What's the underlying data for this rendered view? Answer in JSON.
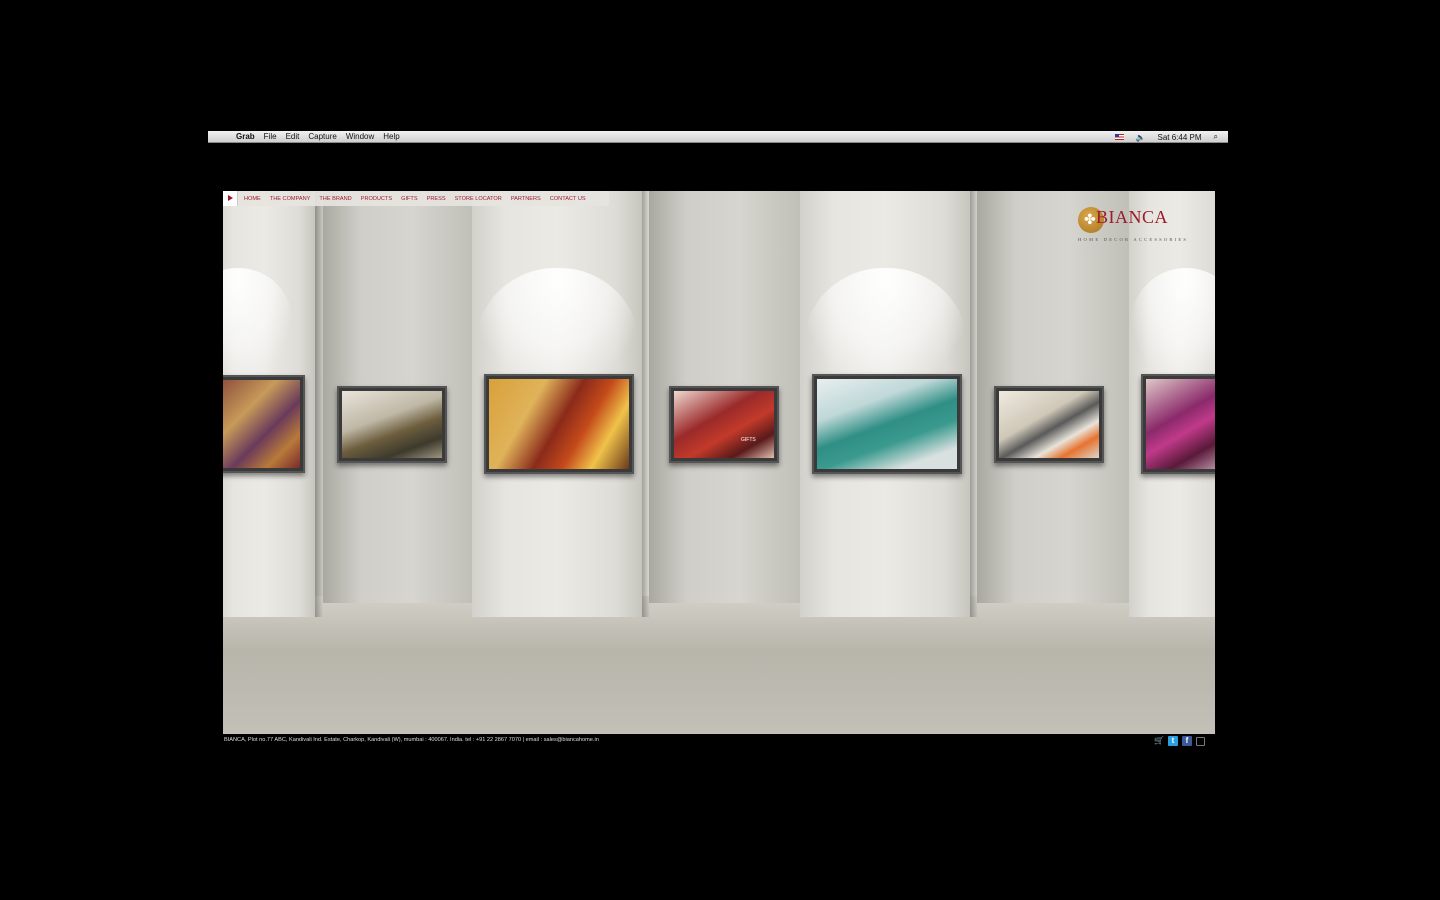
{
  "menubar": {
    "app": "Grab",
    "menus": [
      "File",
      "Edit",
      "Capture",
      "Window",
      "Help"
    ],
    "clock": "Sat 6:44 PM"
  },
  "site": {
    "nav": [
      "HOME",
      "THE COMPANY",
      "THE BRAND",
      "PRODUCTS",
      "GIFTS",
      "PRESS",
      "STORE LOCATOR",
      "PARTNERS",
      "CONTACT US"
    ],
    "logo": {
      "name": "BIANCA",
      "tagline": "HOME DECOR ACCESSORIES"
    },
    "gallery_overlay_label": "GIFTS",
    "footer": "BIANCA, Plot no.77 ABC, Kandivali Ind. Estate, Charkop, Kandivali (W), mumbai : 400067. India.  tel : +91 22 2867 7070  |  email :  sales@biancahome.in"
  },
  "colors": {
    "brand": "#9b1b2a",
    "logo_gold": "#c08a30"
  },
  "icons": [
    "apple-icon",
    "flag-icon",
    "volume-icon",
    "spotlight-icon",
    "cart-icon",
    "twitter-icon",
    "facebook-icon",
    "fullscreen-icon"
  ]
}
